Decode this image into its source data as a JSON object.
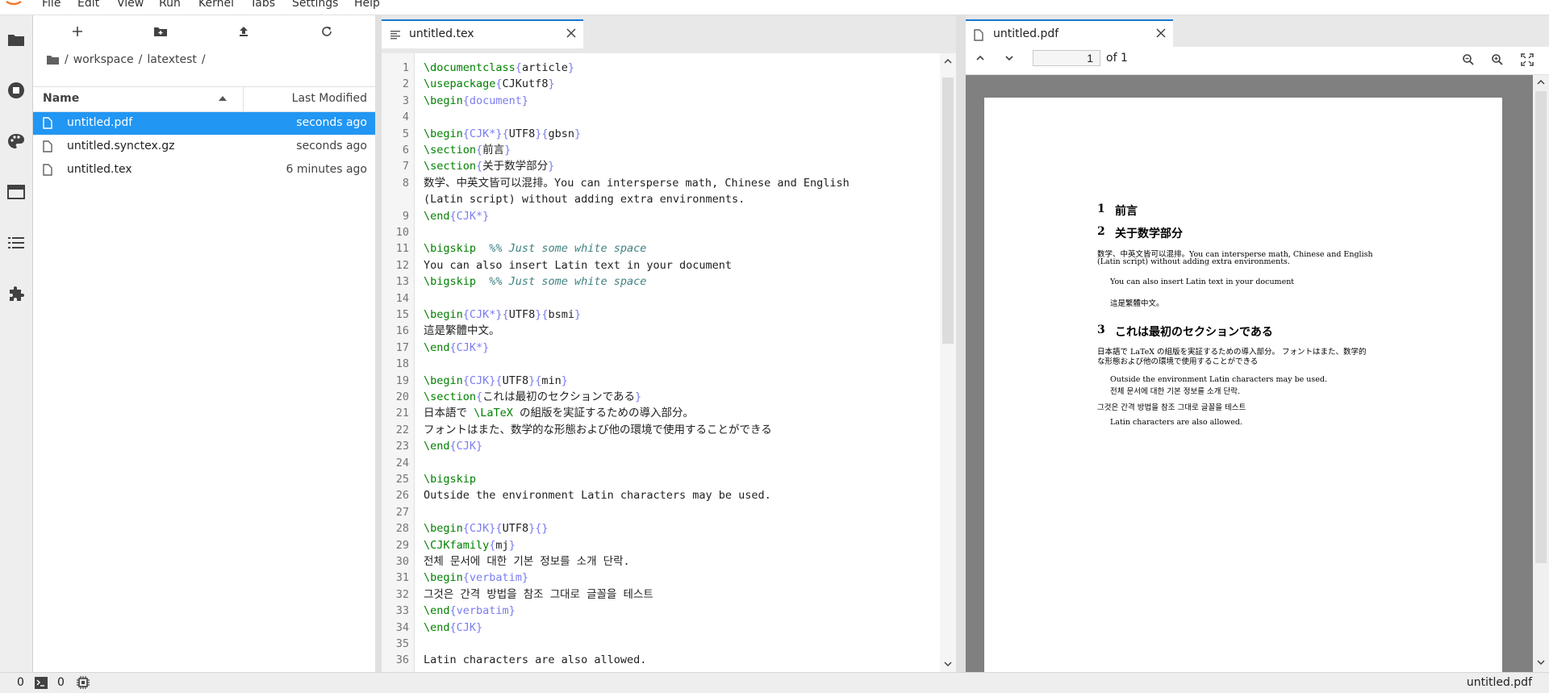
{
  "menubar": {
    "items": [
      "File",
      "Edit",
      "View",
      "Run",
      "Kernel",
      "Tabs",
      "Settings",
      "Help"
    ]
  },
  "activitybar": {
    "icons": [
      "folder-icon",
      "running-icon",
      "palette-icon",
      "tabs-icon",
      "toc-icon",
      "extension-icon"
    ]
  },
  "filebrowser": {
    "breadcrumb": [
      "/",
      "workspace",
      "/",
      "latextest",
      "/"
    ],
    "columns": {
      "name": "Name",
      "modified": "Last Modified"
    },
    "files": [
      {
        "name": "untitled.pdf",
        "modified": "seconds ago",
        "selected": true
      },
      {
        "name": "untitled.synctex.gz",
        "modified": "seconds ago",
        "selected": false
      },
      {
        "name": "untitled.tex",
        "modified": "6 minutes ago",
        "selected": false
      }
    ]
  },
  "editor": {
    "tab_label": "untitled.tex",
    "lines": [
      {
        "n": "1",
        "t": "\\documentclass{article}"
      },
      {
        "n": "2",
        "t": "\\usepackage{CJKutf8}"
      },
      {
        "n": "3",
        "t": "\\begin{document}"
      },
      {
        "n": "4",
        "t": ""
      },
      {
        "n": "5",
        "t": "\\begin{CJK*}{UTF8}{gbsn}"
      },
      {
        "n": "6",
        "t": "\\section{前言}"
      },
      {
        "n": "7",
        "t": "\\section{关于数学部分}"
      },
      {
        "n": "8",
        "t": "数学、中英文皆可以混排。You can intersperse math, Chinese and English"
      },
      {
        "n": "",
        "t": "(Latin script) without adding extra environments."
      },
      {
        "n": "9",
        "t": "\\end{CJK*}"
      },
      {
        "n": "10",
        "t": ""
      },
      {
        "n": "11",
        "t": "\\bigskip  %% Just some white space"
      },
      {
        "n": "12",
        "t": "You can also insert Latin text in your document"
      },
      {
        "n": "13",
        "t": "\\bigskip  %% Just some white space"
      },
      {
        "n": "14",
        "t": ""
      },
      {
        "n": "15",
        "t": "\\begin{CJK*}{UTF8}{bsmi}"
      },
      {
        "n": "16",
        "t": "這是繁體中文。"
      },
      {
        "n": "17",
        "t": "\\end{CJK*}"
      },
      {
        "n": "18",
        "t": ""
      },
      {
        "n": "19",
        "t": "\\begin{CJK}{UTF8}{min}"
      },
      {
        "n": "20",
        "t": "\\section{これは最初のセクションである}"
      },
      {
        "n": "21",
        "t": "日本語で \\LaTeX の組版を実証するための導入部分。"
      },
      {
        "n": "22",
        "t": "フォントはまた、数学的な形態および他の環境で使用することができる"
      },
      {
        "n": "23",
        "t": "\\end{CJK}"
      },
      {
        "n": "24",
        "t": ""
      },
      {
        "n": "25",
        "t": "\\bigskip"
      },
      {
        "n": "26",
        "t": "Outside the environment Latin characters may be used."
      },
      {
        "n": "27",
        "t": ""
      },
      {
        "n": "28",
        "t": "\\begin{CJK}{UTF8}{}"
      },
      {
        "n": "29",
        "t": "\\CJKfamily{mj}"
      },
      {
        "n": "30",
        "t": "전체 문서에 대한 기본 정보를 소개 단락."
      },
      {
        "n": "31",
        "t": "\\begin{verbatim}"
      },
      {
        "n": "32",
        "t": "그것은 간격 방법을 참조 그대로 글꼴을 테스트"
      },
      {
        "n": "33",
        "t": "\\end{verbatim}"
      },
      {
        "n": "34",
        "t": "\\end{CJK}"
      },
      {
        "n": "35",
        "t": ""
      },
      {
        "n": "36",
        "t": "Latin characters are also allowed."
      }
    ]
  },
  "pdf": {
    "tab_label": "untitled.pdf",
    "page_value": "1",
    "page_of": "of 1",
    "content": {
      "h1_num": "1",
      "h1": "前言",
      "h2_num": "2",
      "h2": "关于数学部分",
      "p1a": "数学、中英文皆可以混排。You can intersperse math, Chinese and English",
      "p1b": "(Latin script) without adding extra environments.",
      "p2": "You can also insert Latin text in your document",
      "p3": "這是繁體中文。",
      "h3_num": "3",
      "h3": "これは最初のセクションである",
      "p4a": "日本語で LaTeX の組版を実証するための導入部分。 フォントはまた、数学的",
      "p4b": "な形態および他の環境で使用することができる",
      "p5": "Outside the environment Latin characters may be used.",
      "p6": "전체 문서에 대한 기본 정보를 소개 단락.",
      "p7": "그것은 간격 방법을 참조 그대로 글꼴을 테스트",
      "p8": "Latin characters are also allowed."
    }
  },
  "statusbar": {
    "terminals": "0",
    "kernels": "0",
    "filename": "untitled.pdf"
  }
}
